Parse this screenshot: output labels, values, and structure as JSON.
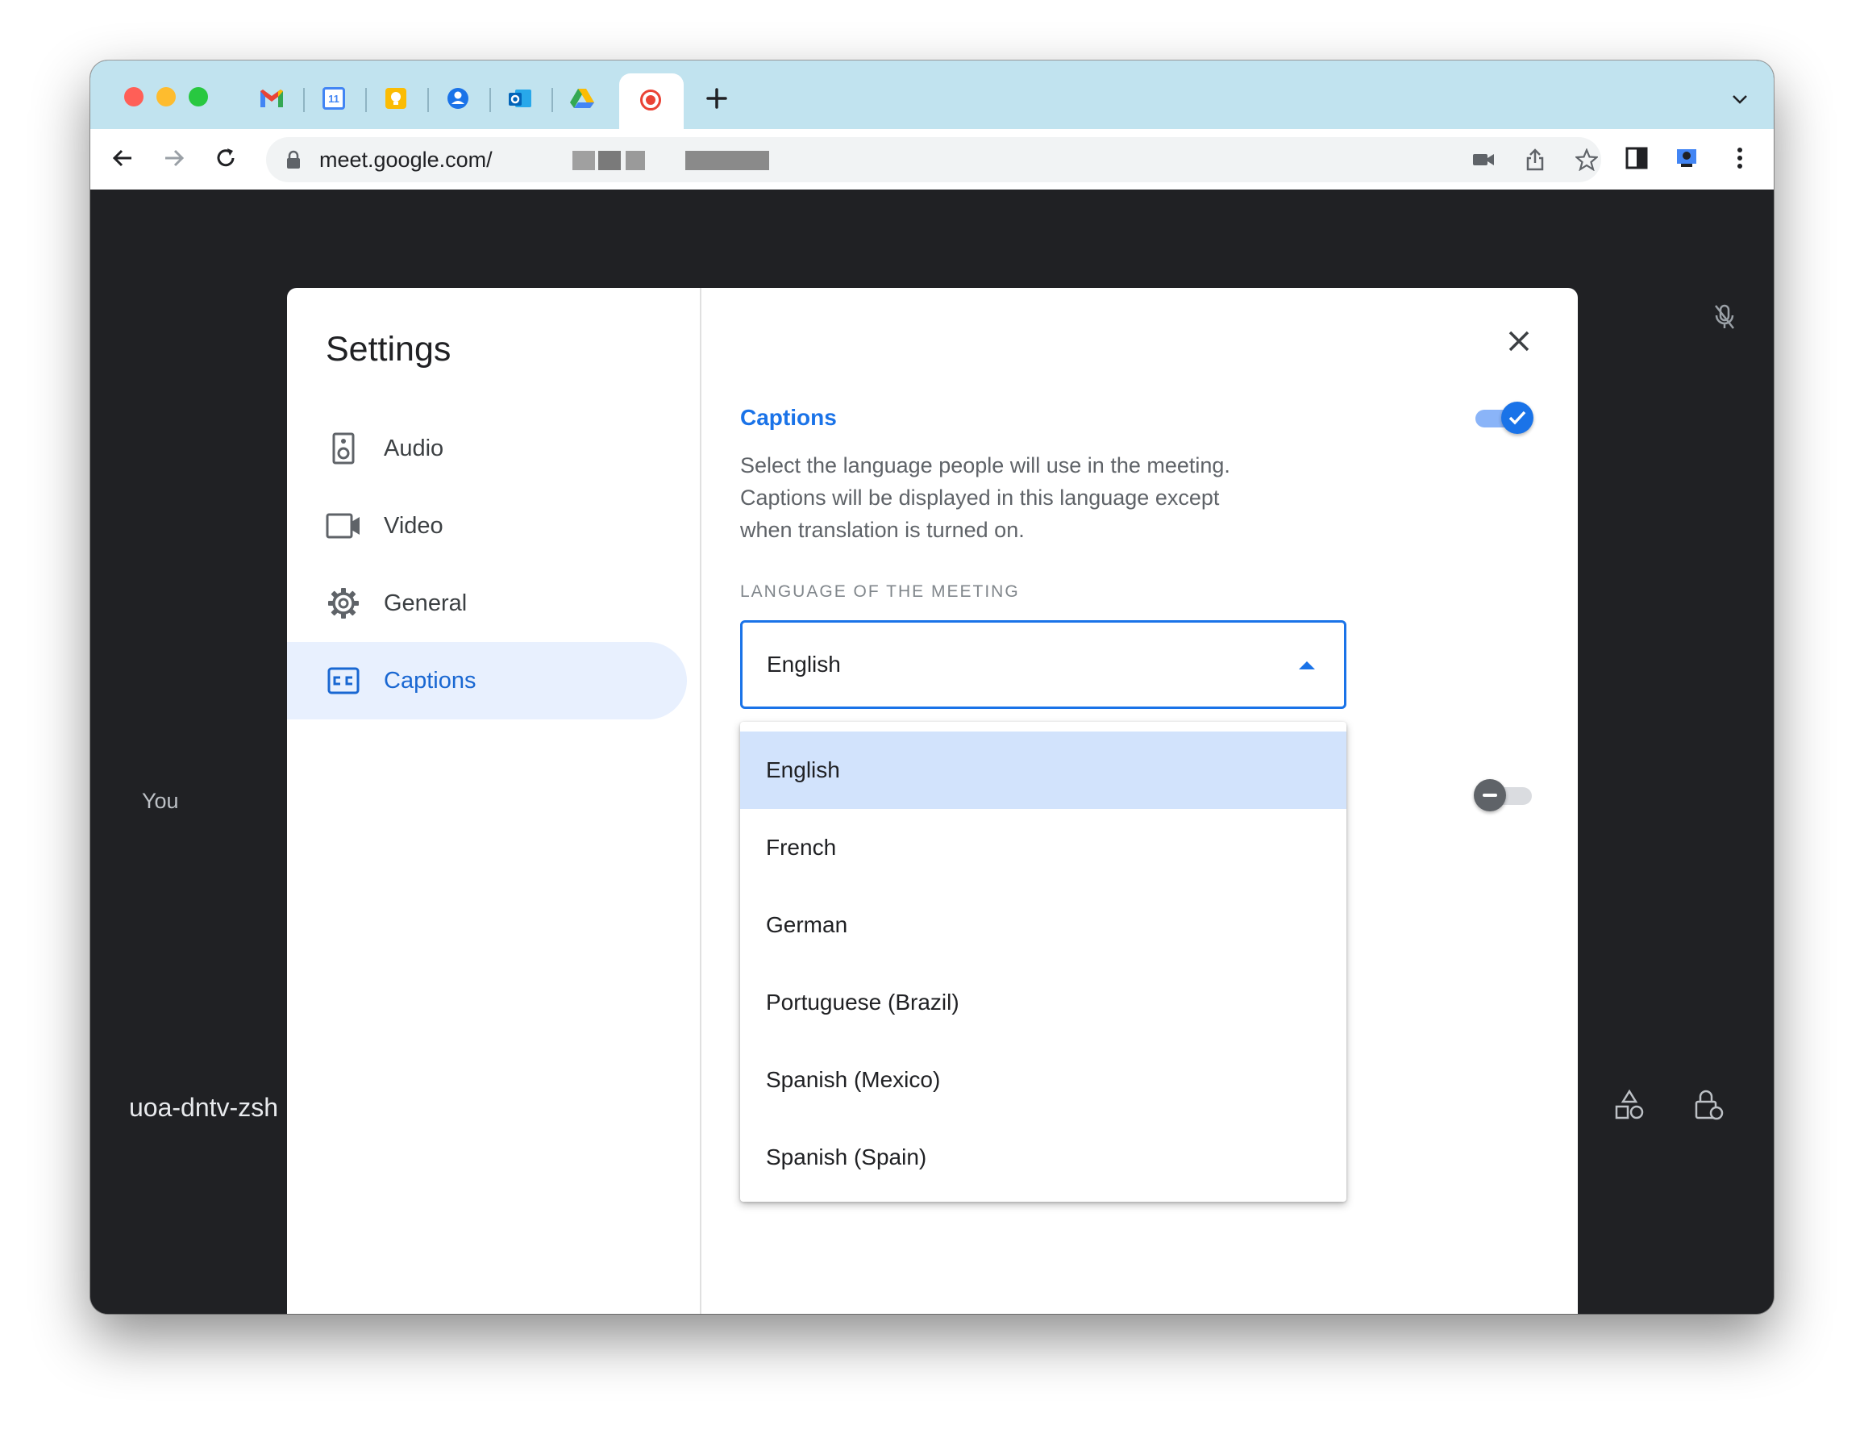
{
  "browser": {
    "url": "meet.google.com/",
    "pinned_tabs": [
      "gmail-icon",
      "calendar-icon",
      "keep-icon",
      "contacts-icon",
      "outlook-icon",
      "drive-icon"
    ],
    "active_tab_icon": "record-icon",
    "calendar_day": "11"
  },
  "meeting": {
    "self_label": "You",
    "code": "uoa-dntv-zsh"
  },
  "settings": {
    "title": "Settings",
    "nav": [
      {
        "label": "Audio",
        "icon": "speaker-icon"
      },
      {
        "label": "Video",
        "icon": "video-camera-icon"
      },
      {
        "label": "General",
        "icon": "gear-icon"
      },
      {
        "label": "Captions",
        "icon": "closed-captions-icon",
        "active": true
      }
    ],
    "captions": {
      "title": "Captions",
      "enabled": true,
      "description": "Select the language people will use in the meeting. Captions will be displayed in this language except when translation is turned on.",
      "field_label": "LANGUAGE OF THE MEETING",
      "selected_language": "English",
      "options": [
        "English",
        "French",
        "German",
        "Portuguese (Brazil)",
        "Spanish (Mexico)",
        "Spanish (Spain)"
      ],
      "second_toggle_enabled": false
    }
  },
  "colors": {
    "accent": "#1a73e8",
    "active_nav_bg": "#e8f0fe",
    "selected_option_bg": "#d2e3fc",
    "tabbar": "#c1e3ef",
    "meeting_bg": "#202124"
  }
}
